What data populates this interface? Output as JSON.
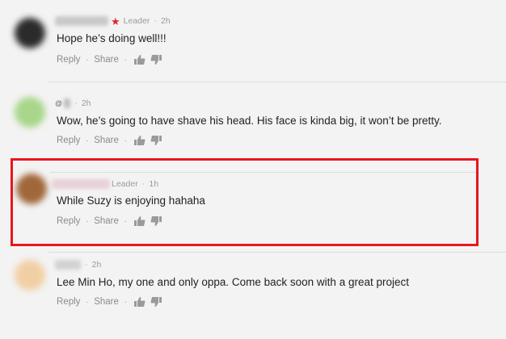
{
  "comments": [
    {
      "author_blurred": true,
      "badge": "Leader",
      "has_star": true,
      "time": "2h",
      "text": "Hope he’s doing well!!!",
      "reply": "Reply",
      "share": "Share"
    },
    {
      "author_blurred": true,
      "mention_glyph": "@",
      "time": "2h",
      "text": "Wow, he’s going to have shave his head.  His face is kinda big, it won’t be pretty.",
      "reply": "Reply",
      "share": "Share"
    },
    {
      "author_blurred": true,
      "badge": "Leader",
      "time": "1h",
      "text": "While Suzy is enjoying hahaha",
      "reply": "Reply",
      "share": "Share"
    },
    {
      "author_blurred": true,
      "time": "2h",
      "text": "Lee Min Ho, my one and only oppa. Come back soon with a great project",
      "reply": "Reply",
      "share": "Share"
    }
  ],
  "colors": {
    "highlight": "#e8161c",
    "star": "#e0262f",
    "avatar_1": "#2b2b2b",
    "avatar_2": "#a8d68a",
    "avatar_3": "#a0673a",
    "avatar_4": "#f1cfa4"
  },
  "icons": {
    "like": "thumbs-up-icon",
    "dislike": "thumbs-down-icon",
    "leader": "star-icon"
  }
}
